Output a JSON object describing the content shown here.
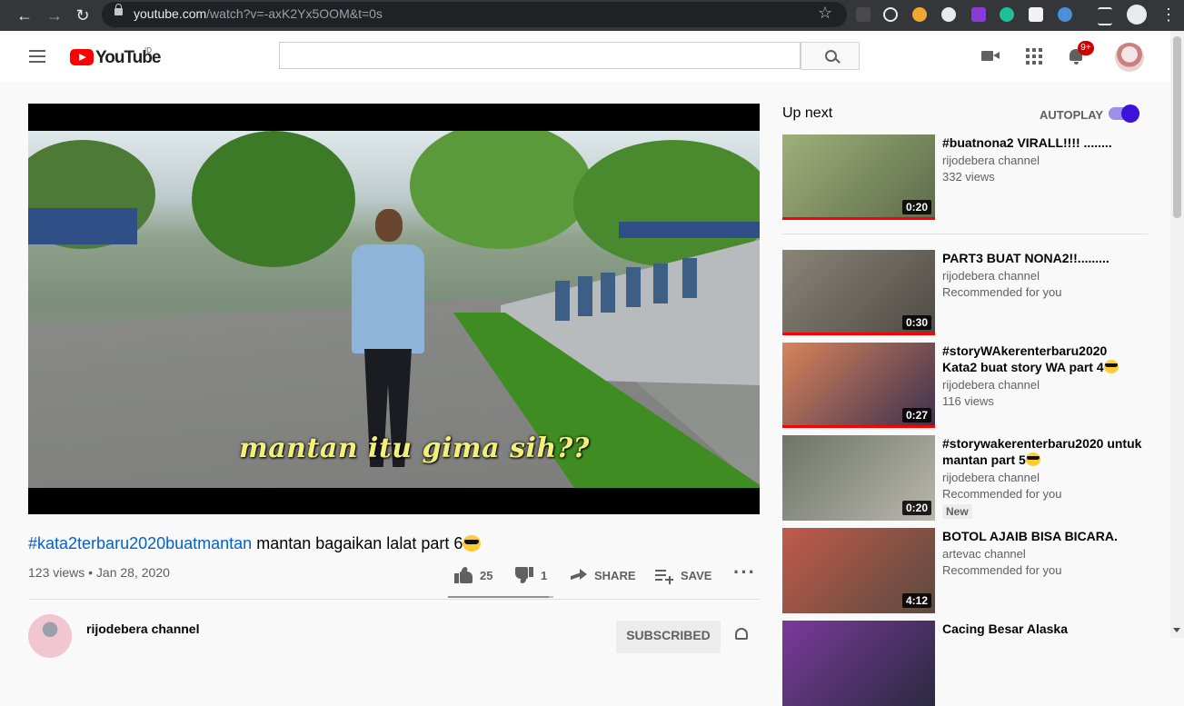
{
  "browser": {
    "url_host": "youtube.com",
    "url_path": "/watch?v=-axK2Yx5OOM&t=0s"
  },
  "masthead": {
    "logo_text": "YouTube",
    "country_code": "ID",
    "search_value": "",
    "notification_count": "9+"
  },
  "video": {
    "caption": "mantan itu gima sih??",
    "hashtag": "#kata2terbaru2020buatmantan",
    "title_rest": " mantan bagaikan lalat part 6",
    "views_date": "123 views • Jan 28, 2020",
    "likes": "25",
    "dislikes": "1",
    "share_label": "SHARE",
    "save_label": "SAVE",
    "like_ratio": 0.96,
    "channel_name": "rijodebera channel",
    "subscribe_label": "SUBSCRIBED"
  },
  "sidebar": {
    "up_next_label": "Up next",
    "autoplay_label": "AUTOPLAY",
    "autoplay_on": true,
    "items": [
      {
        "title": "#buatnona2 VIRALL!!!! ........",
        "channel": "rijodebera channel",
        "info": "332 views",
        "duration": "0:20",
        "watched": 1.0,
        "thumb_colors": [
          "#9fb07a",
          "#5c6b4a"
        ]
      },
      {
        "title": "PART3 BUAT NONA2!!.........",
        "channel": "rijodebera channel",
        "info": "Recommended for you",
        "duration": "0:30",
        "watched": 1.0,
        "thumb_colors": [
          "#8a8478",
          "#4e4b45"
        ]
      },
      {
        "title": "#storyWAkerenterbaru2020 Kata2 buat story WA part 4",
        "channel": "rijodebera channel",
        "info": "116 views",
        "duration": "0:27",
        "watched": 1.0,
        "thumb_colors": [
          "#d9835a",
          "#3a3050"
        ]
      },
      {
        "title": "#storywakerenterbaru2020 untuk mantan part 5",
        "channel": "rijodebera channel",
        "info": "Recommended for you",
        "badge": "New",
        "duration": "0:20",
        "watched": 0,
        "thumb_colors": [
          "#6f7468",
          "#b8b7ae"
        ]
      },
      {
        "title": "BOTOL AJAIB BISA BICARA.",
        "channel": "artevac channel",
        "info": "Recommended for you",
        "duration": "4:12",
        "watched": 0,
        "thumb_colors": [
          "#c05a4a",
          "#5a4a40"
        ]
      },
      {
        "title": "Cacing Besar Alaska",
        "channel": "",
        "info": "",
        "duration": "",
        "watched": 0,
        "thumb_colors": [
          "#7a3a9a",
          "#2a2a40"
        ]
      }
    ]
  }
}
